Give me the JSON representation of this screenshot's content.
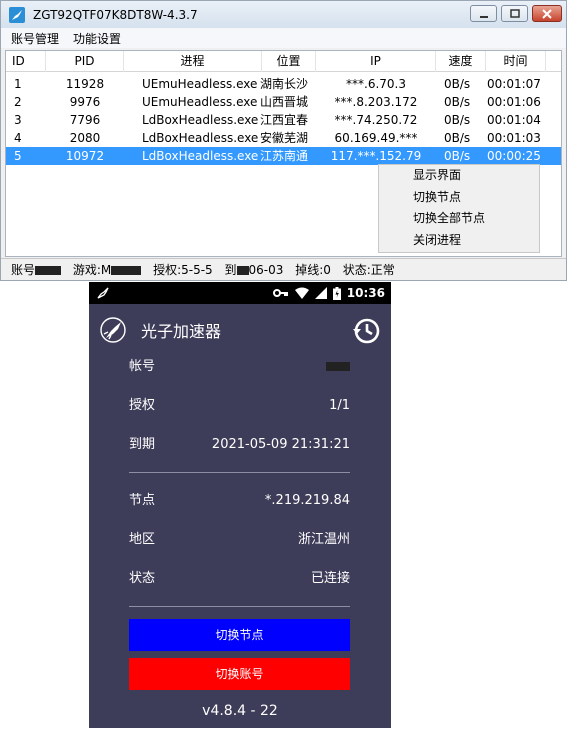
{
  "window": {
    "title": "ZGT92QTF07K8DT8W-4.3.7",
    "controls": {
      "minimize": "minimize-icon",
      "maximize": "maximize-icon",
      "close": "close-icon"
    }
  },
  "menu": [
    "账号管理",
    "功能设置"
  ],
  "table": {
    "headers": [
      "ID",
      "PID",
      "进程",
      "位置",
      "IP",
      "速度",
      "时间"
    ],
    "rows": [
      [
        "1",
        "11928",
        "UEmuHeadless.exe",
        "湖南长沙",
        "***.6.70.3",
        "0B/s",
        "00:01:07"
      ],
      [
        "2",
        "9976",
        "UEmuHeadless.exe",
        "山西晋城",
        "***.8.203.172",
        "0B/s",
        "00:01:06"
      ],
      [
        "3",
        "7796",
        "LdBoxHeadless.exe",
        "江西宜春",
        "***.74.250.72",
        "0B/s",
        "00:01:04"
      ],
      [
        "4",
        "2080",
        "LdBoxHeadless.exe",
        "安徽芜湖",
        "60.169.49.***",
        "0B/s",
        "00:01:03"
      ],
      [
        "5",
        "10972",
        "LdBoxHeadless.exe",
        "江苏南通",
        "117.***.152.79",
        "0B/s",
        "00:00:25"
      ]
    ],
    "selected_row": 5
  },
  "context_menu": [
    "显示界面",
    "切换节点",
    "切换全部节点",
    "关闭进程"
  ],
  "status": {
    "account_label": "账号",
    "game_label": "游戏:M",
    "auth": "授权:5-5-5",
    "expire_label": "到",
    "expire_suffix": "06-03",
    "drop": "掉线:0",
    "state": "状态:正常"
  },
  "phone": {
    "statusbar_time": "10:36",
    "app_title": "光子加速器",
    "fields": [
      {
        "label": "帐号",
        "value": ""
      },
      {
        "label": "授权",
        "value": "1/1"
      },
      {
        "label": "到期",
        "value": "2021-05-09 21:31:21"
      },
      {
        "label": "节点",
        "value": "*.219.219.84"
      },
      {
        "label": "地区",
        "value": "浙江温州"
      },
      {
        "label": "状态",
        "value": "已连接"
      }
    ],
    "switch_node_button": "切换节点",
    "switch_account_button": "切换账号",
    "version": "v4.8.4 - 22",
    "colors": {
      "background": "#3d3c59",
      "switch_node": "#0000ff",
      "switch_account": "#ff0000"
    }
  }
}
